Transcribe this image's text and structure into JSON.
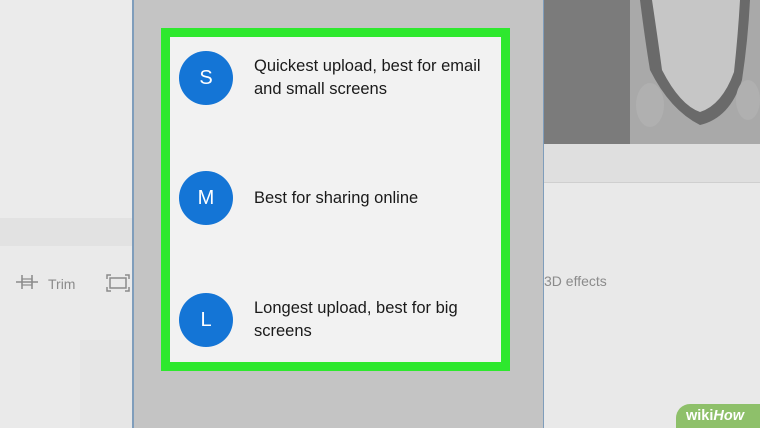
{
  "toolbar": {
    "trim_label": "Trim",
    "effects_label": "3D effects"
  },
  "quality_options": [
    {
      "letter": "S",
      "description": "Quickest upload, best for email and small screens"
    },
    {
      "letter": "M",
      "description": "Best for sharing online"
    },
    {
      "letter": "L",
      "description": "Longest upload, best for big screens"
    }
  ],
  "watermark": {
    "prefix": "wiki",
    "suffix": "How"
  },
  "colors": {
    "highlight": "#2ee82e",
    "accent": "#1475d6",
    "panel_bg": "#f2f2f2"
  }
}
